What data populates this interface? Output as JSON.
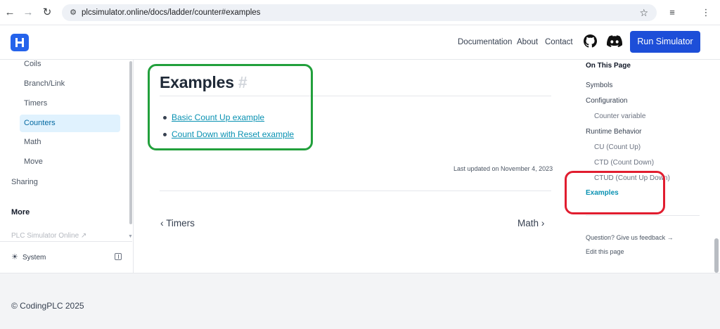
{
  "browser": {
    "url": "plcsimulator.online/docs/ladder/counter#examples",
    "back_icon": "arrow-left-icon",
    "forward_icon": "arrow-right-icon",
    "reload_icon": "reload-icon"
  },
  "header": {
    "nav": [
      "Documentation",
      "About",
      "Contact"
    ],
    "run_button": "Run Simulator",
    "brand_color": "#1d4ed8"
  },
  "sidebar": {
    "items": [
      "Coils",
      "Branch/Link",
      "Timers",
      "Counters",
      "Math",
      "Move"
    ],
    "active_item": "Counters",
    "sharing": "Sharing",
    "more_heading": "More",
    "external_link": "PLC Simulator Online ↗",
    "system_label": "System"
  },
  "main": {
    "heading": "Examples",
    "heading_anchor": "#",
    "examples": [
      "Basic Count Up example",
      "Count Down with Reset example"
    ],
    "last_updated": "Last updated on November 4, 2023",
    "prev": "Timers",
    "next": "Math"
  },
  "toc": {
    "title": "On This Page",
    "symbols": "Symbols",
    "configuration": "Configuration",
    "counter_variable": "Counter variable",
    "runtime_behavior": "Runtime Behavior",
    "cu": "CU (Count Up)",
    "ctd": "CTD (Count Down)",
    "ctud": "CTUD (Count Up Down)",
    "examples": "Examples",
    "feedback": "Question? Give us feedback →",
    "edit": "Edit this page"
  },
  "footer": {
    "copyright": "© CodingPLC 2025"
  },
  "annotation_colors": {
    "green_frame": "#22a03c",
    "red_frame": "#e11d2f"
  }
}
